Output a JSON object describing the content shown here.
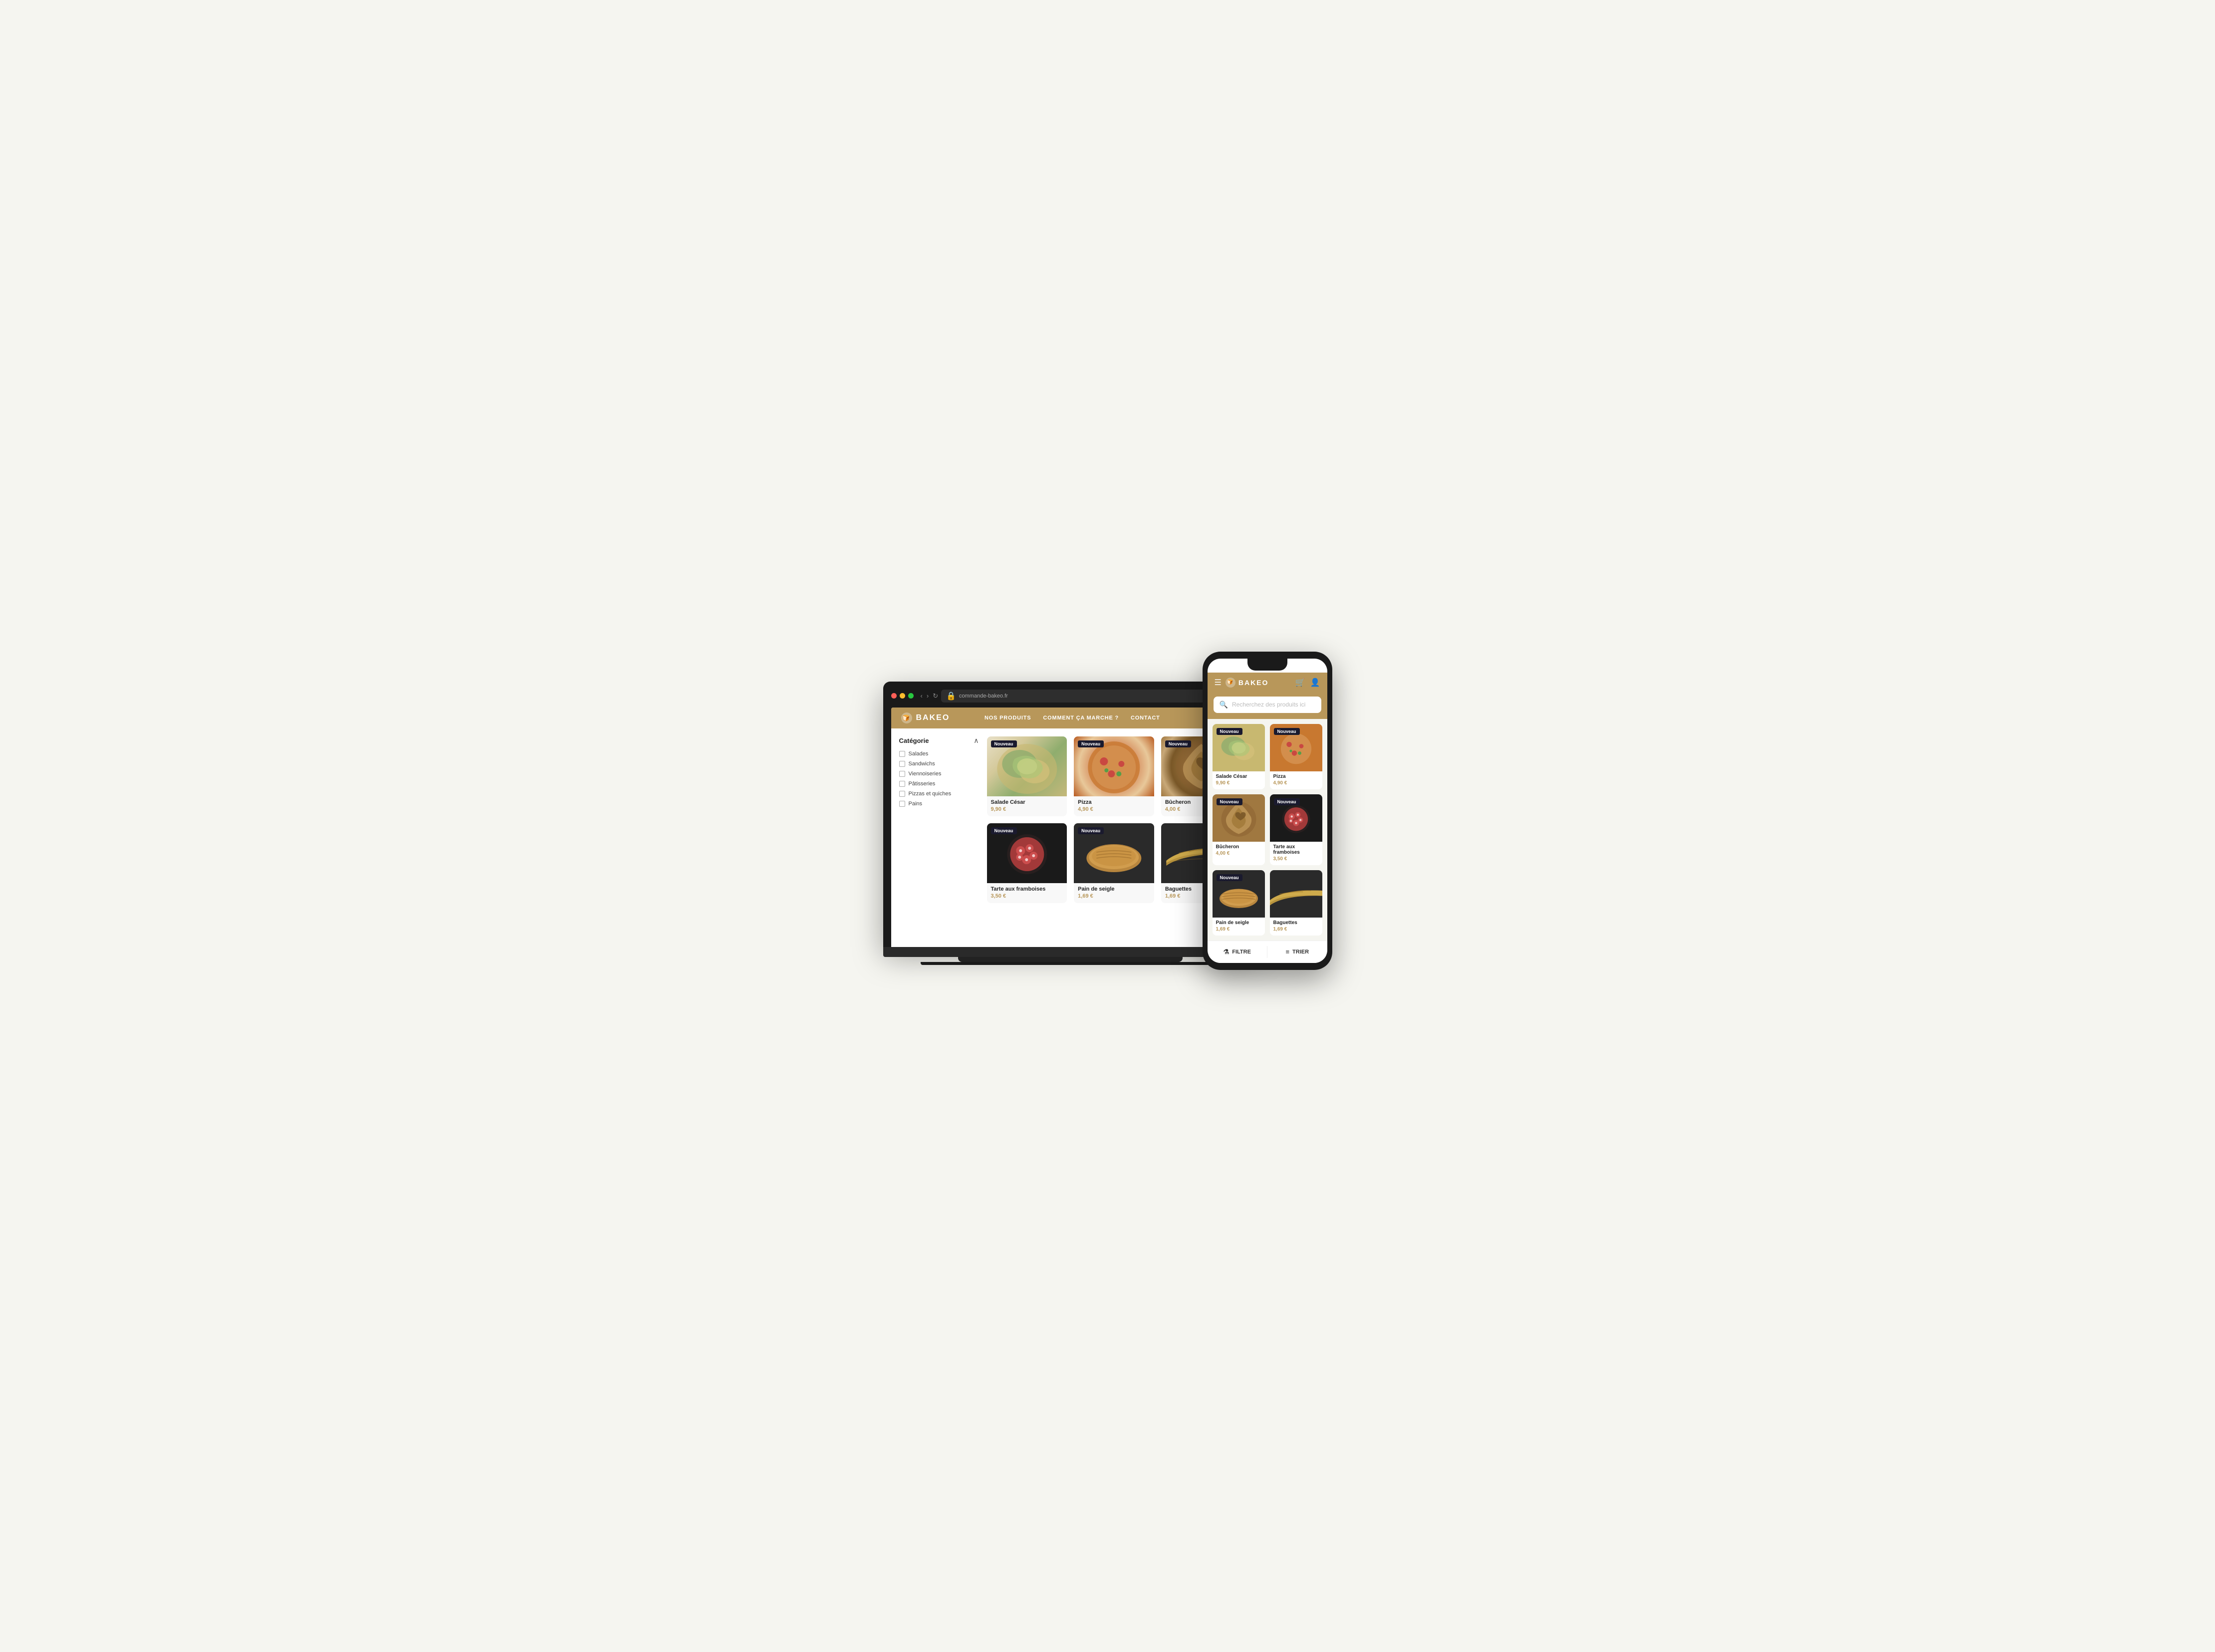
{
  "brand": {
    "name": "BAKEO",
    "icon": "🍞"
  },
  "laptop": {
    "address_bar": {
      "url": "commande-bakeo.fr",
      "lock_icon": "🔒"
    },
    "nav": {
      "links": [
        {
          "label": "NOS PRODUITS"
        },
        {
          "label": "COMMENT ÇA MARCHE ?"
        },
        {
          "label": "CONTACT"
        }
      ]
    },
    "sidebar": {
      "title": "Catégorie",
      "filters": [
        {
          "label": "Salades"
        },
        {
          "label": "Sandwichs"
        },
        {
          "label": "Viennoiseries"
        },
        {
          "label": "Pâtisseries"
        },
        {
          "label": "Pizzas et quiches"
        },
        {
          "label": "Pains"
        }
      ]
    },
    "products": [
      {
        "name": "Salade César",
        "price": "9,90 €",
        "badge": "Nouveau",
        "style": "salade-cesar"
      },
      {
        "name": "Pizza",
        "price": "4,90 €",
        "badge": "Nouveau",
        "style": "pizza"
      },
      {
        "name": "Bûcheron",
        "price": "4,00 €",
        "badge": "Nouveau",
        "style": "bucheron"
      },
      {
        "name": "Tarte aux framboises",
        "price": "3,50 €",
        "badge": "Nouveau",
        "style": "tarte-framboises"
      },
      {
        "name": "Pain de seigle",
        "price": "1,69 €",
        "badge": "Nouveau",
        "style": "pain-seigle"
      },
      {
        "name": "Baguettes",
        "price": "1,69 €",
        "badge": "",
        "style": "baguettes"
      }
    ]
  },
  "mobile": {
    "search": {
      "placeholder": "Recherchez des produits ici"
    },
    "products": [
      {
        "name": "Salade César",
        "price": "9,90 €",
        "badge": "Nouveau",
        "style": "salade-cesar"
      },
      {
        "name": "Pizza",
        "price": "4,90 €",
        "badge": "Nouveau",
        "style": "pizza"
      },
      {
        "name": "Bûcheron",
        "price": "4,00 €",
        "badge": "Nouveau",
        "style": "bucheron"
      },
      {
        "name": "Tarte aux framboises",
        "price": "3,50 €",
        "badge": "Nouveau",
        "style": "tarte-framboises"
      },
      {
        "name": "Pain de seigle",
        "price": "1,69 €",
        "badge": "Nouveau",
        "style": "pain-seigle"
      },
      {
        "name": "Baguettes",
        "price": "1,69 €",
        "badge": "",
        "style": "baguettes"
      }
    ],
    "bottom_bar": {
      "filter_label": "FILTRE",
      "sort_label": "TRIER"
    }
  },
  "colors": {
    "brand": "#b8975a",
    "dark": "#1a1a2e",
    "price": "#b8975a"
  }
}
